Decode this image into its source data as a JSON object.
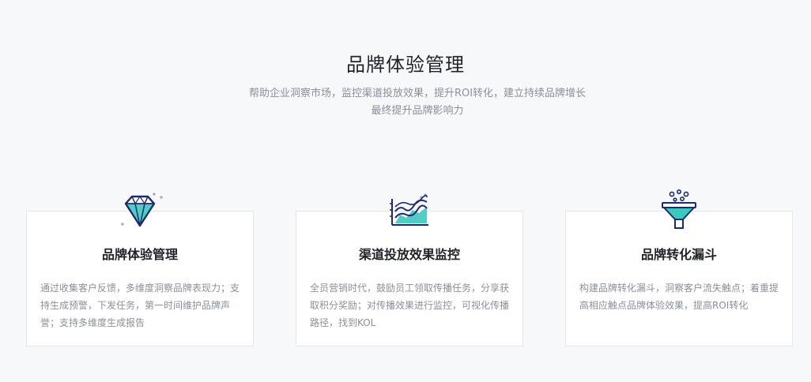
{
  "header": {
    "title": "品牌体验管理",
    "subtitle_line1": "帮助企业洞察市场，监控渠道投放效果，提升ROI转化，建立持续品牌增长",
    "subtitle_line2": "最终提升品牌影响力"
  },
  "cards": [
    {
      "icon": "diamond-icon",
      "title": "品牌体验管理",
      "desc": "通过收集客户反馈，多维度洞察品牌表现力；支持生成预警，下发任务，第一时间维护品牌声誉；支持多维度生成报告"
    },
    {
      "icon": "line-chart-icon",
      "title": "渠道投放效果监控",
      "desc": "全员营销时代，鼓励员工领取传播任务，分享获取积分奖励；对传播效果进行监控，可视化传播路径，找到KOL"
    },
    {
      "icon": "funnel-icon",
      "title": "品牌转化漏斗",
      "desc": "构建品牌转化漏斗，洞察客户流失触点；着重提高相应触点品牌体验效果，提高ROI转化"
    }
  ],
  "colors": {
    "accent_teal": "#3cc8c0",
    "icon_navy": "#1f2a6b",
    "text_dark": "#1f2329",
    "text_gray": "#8a8f99"
  }
}
